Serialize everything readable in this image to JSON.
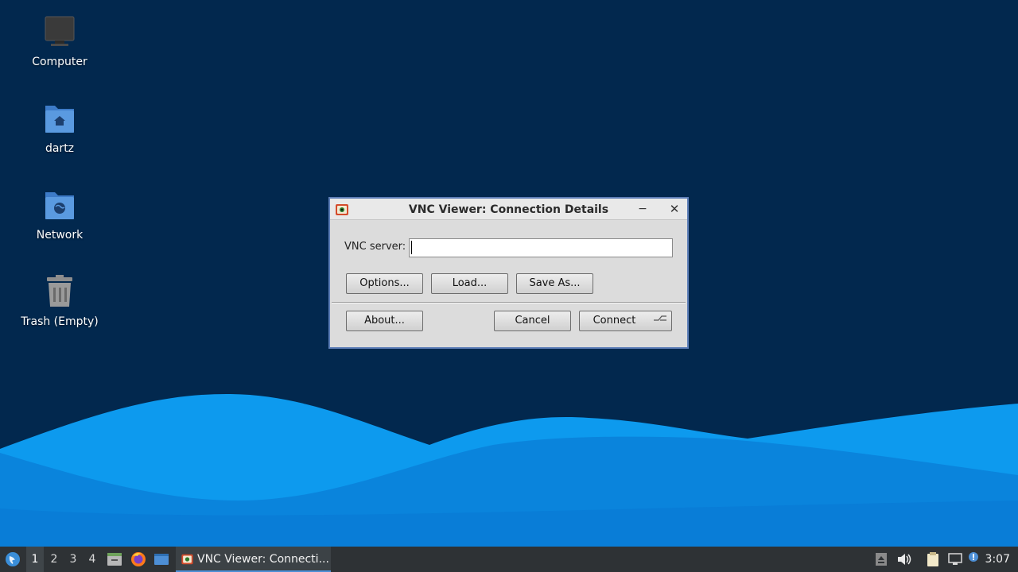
{
  "desktop": {
    "icons": [
      {
        "label": "Computer",
        "icon": "computer-icon"
      },
      {
        "label": "dartz",
        "icon": "home-folder-icon"
      },
      {
        "label": "Network",
        "icon": "network-folder-icon"
      },
      {
        "label": "Trash (Empty)",
        "icon": "trash-icon"
      }
    ]
  },
  "dialog": {
    "title": "VNC Viewer: Connection Details",
    "minimize_glyph": "−",
    "close_glyph": "✕",
    "server_label": "VNC server:",
    "server_value": "",
    "buttons": {
      "options": "Options...",
      "load": "Load...",
      "save_as": "Save As...",
      "about": "About...",
      "cancel": "Cancel",
      "connect": "Connect"
    }
  },
  "taskbar": {
    "workspaces": [
      "1",
      "2",
      "3",
      "4"
    ],
    "active_workspace": "1",
    "launchers": [
      "start-menu-icon",
      "file-manager-icon",
      "firefox-icon",
      "show-desktop-icon"
    ],
    "task_label": "VNC Viewer: Connecti...",
    "tray": [
      "eject-icon",
      "volume-icon",
      "clipboard-icon",
      "network-icon",
      "notification-icon"
    ],
    "clock": "3:07"
  },
  "colors": {
    "desktop_bg": "#02284e",
    "wave_light": "#0a8fe6",
    "wave_dark": "#0774d0",
    "taskbar_bg": "#2e3235",
    "accent": "#4d8fd6"
  }
}
